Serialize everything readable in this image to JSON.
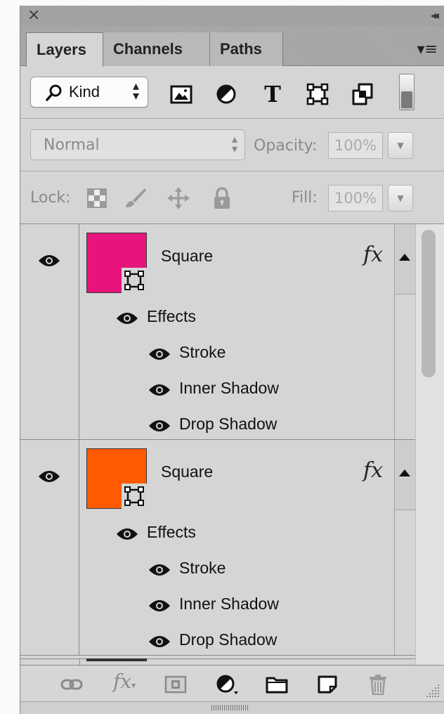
{
  "panel": {
    "title_close": "×",
    "title_collapse": "◂◂",
    "tabs": [
      {
        "label": "Layers",
        "active": true
      },
      {
        "label": "Channels",
        "active": false
      },
      {
        "label": "Paths",
        "active": false
      }
    ],
    "tab_menu": "▾≡"
  },
  "filter": {
    "kind_label": "Kind",
    "kind_arrows": "⬍",
    "icons": [
      "pixel-layer-filter-icon",
      "adjustment-layer-filter-icon",
      "type-layer-filter-icon",
      "shape-layer-filter-icon",
      "smart-object-filter-icon"
    ],
    "type_glyph": "T"
  },
  "blend": {
    "mode": "Normal",
    "opacity_label": "Opacity:",
    "opacity_value": "100%"
  },
  "lock": {
    "label": "Lock:",
    "fill_label": "Fill:",
    "fill_value": "100%"
  },
  "layers": [
    {
      "name": "Square",
      "color": "#e8147e",
      "fx": "fx",
      "effects_label": "Effects",
      "effects": [
        "Stroke",
        "Inner Shadow",
        "Drop Shadow"
      ]
    },
    {
      "name": "Square",
      "color": "#ff5a00",
      "fx": "fx",
      "effects_label": "Effects",
      "effects": [
        "Stroke",
        "Inner Shadow",
        "Drop Shadow"
      ]
    }
  ],
  "toolbar": {
    "fx": "fx"
  },
  "colors": {
    "panel_bg": "#d5d5d5",
    "layer1": "#e8147e",
    "layer2": "#ff5a00"
  }
}
